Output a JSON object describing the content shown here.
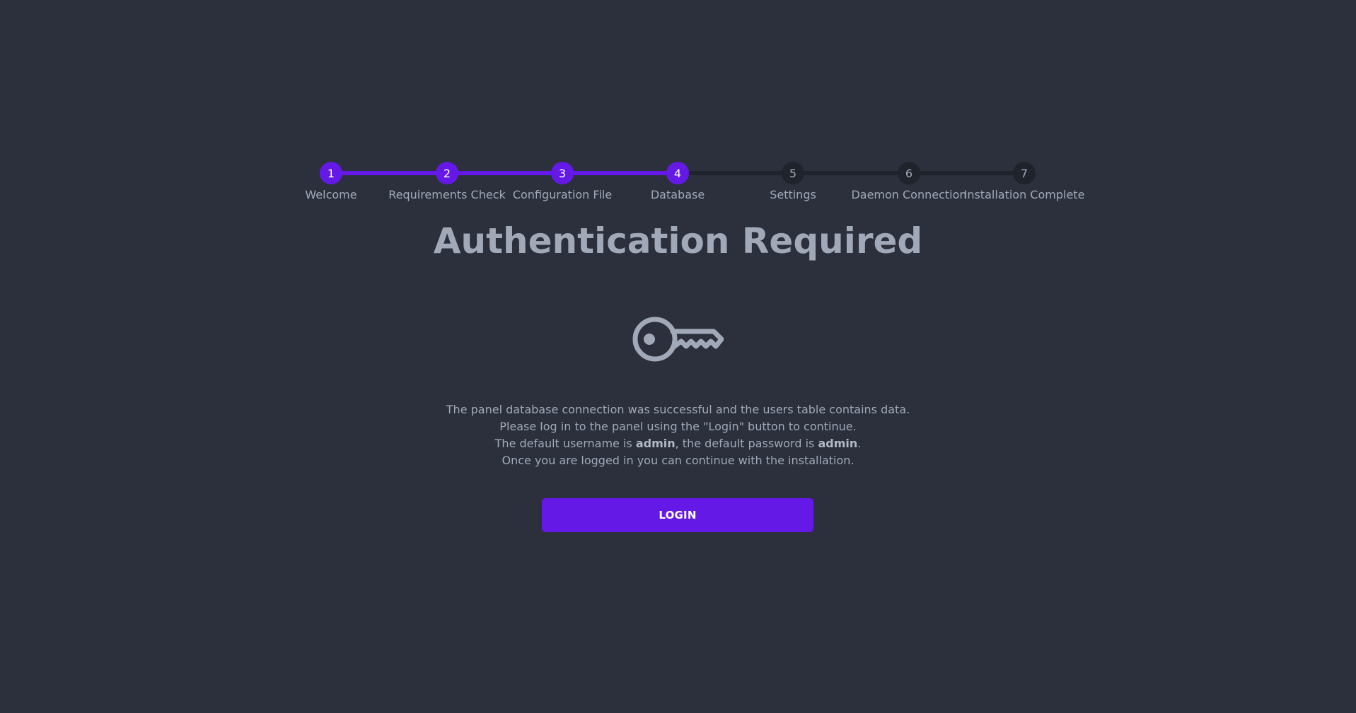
{
  "stepper": {
    "steps": [
      {
        "number": "1",
        "label": "Welcome",
        "state": "done"
      },
      {
        "number": "2",
        "label": "Requirements Check",
        "state": "done"
      },
      {
        "number": "3",
        "label": "Configuration File",
        "state": "done"
      },
      {
        "number": "4",
        "label": "Database",
        "state": "done"
      },
      {
        "number": "5",
        "label": "Settings",
        "state": "todo"
      },
      {
        "number": "6",
        "label": "Daemon Connection",
        "state": "todo"
      },
      {
        "number": "7",
        "label": "Installation Complete",
        "state": "todo"
      }
    ]
  },
  "main": {
    "title": "Authentication Required",
    "icon": "key-icon",
    "message": {
      "line1": "The panel database connection was successful and the users table contains data.",
      "line2": "Please log in to the panel using the \"Login\" button to continue.",
      "line3_prefix": "The default username is ",
      "line3_username": "admin",
      "line3_middle": ", the default password is ",
      "line3_password": "admin",
      "line3_suffix": ".",
      "line4": "Once you are logged in you can continue with the installation."
    },
    "login_label": "LOGIN"
  },
  "colors": {
    "background": "#2b303c",
    "accent": "#6419e6",
    "inactive_step": "#1f232b",
    "text": "#a1a9b8"
  }
}
